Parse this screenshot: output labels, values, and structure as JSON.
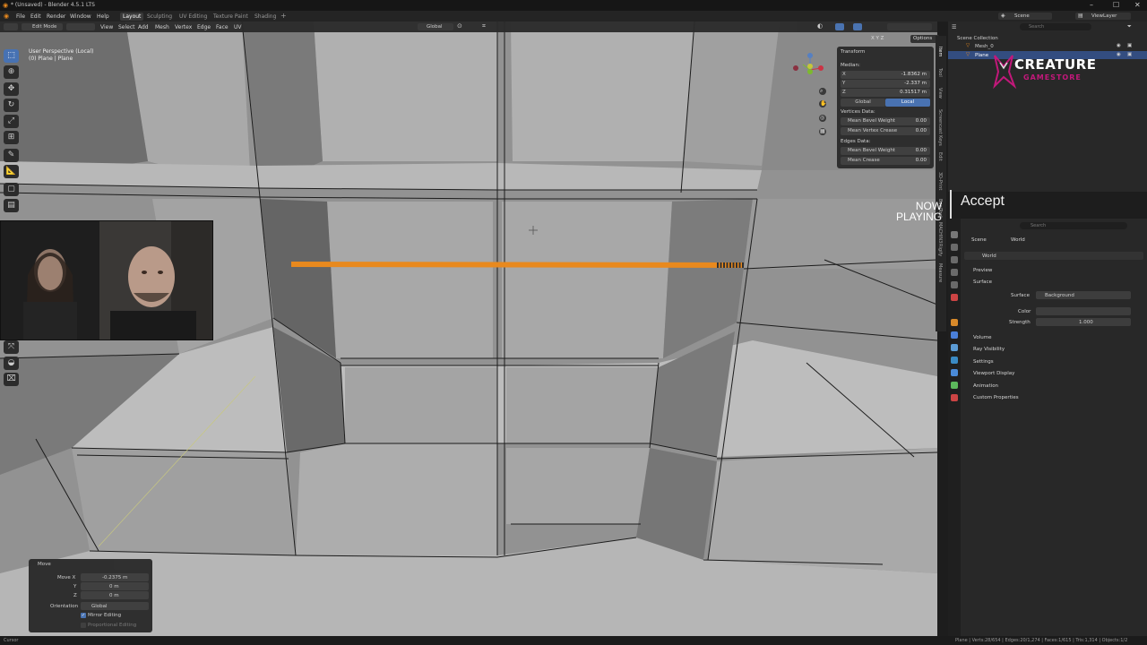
{
  "window": {
    "title": "* (Unsaved) - Blender 4.5.1 LTS"
  },
  "menus": [
    "File",
    "Edit",
    "Render",
    "Window",
    "Help"
  ],
  "workspaces": [
    "Layout",
    "Sculpting",
    "UV Editing",
    "Texture Paint",
    "Shading"
  ],
  "scene": {
    "scene_label": "Scene",
    "view_layer_label": "ViewLayer"
  },
  "viewport": {
    "mode": "Edit Mode",
    "menu": [
      "View",
      "Select",
      "Add",
      "Mesh",
      "Vertex",
      "Edge",
      "Face",
      "UV"
    ],
    "transform_orientation": "Global",
    "options_label": "Options",
    "axes_label": "X Y Z",
    "info_line1": "User Perspective (Local)",
    "info_line2": "(0) Plane | Plane"
  },
  "npanel": {
    "title": "Transform",
    "median": "Median:",
    "x_label": "X",
    "x_value": "-1.8362 m",
    "y_label": "Y",
    "y_value": "-2.337 m",
    "z_label": "Z",
    "z_value": "0.31517 m",
    "global_label": "Global",
    "local_label": "Local",
    "vertices_data": "Vertices Data:",
    "mean_bevel_weight": "Mean Bevel Weight",
    "mean_bevel_weight_value": "0.00",
    "mean_vertex_crease": "Mean Vertex Crease",
    "mean_vertex_crease_value": "0.00",
    "edges_data": "Edges Data:",
    "edge_bevel_weight": "Mean Bevel Weight",
    "edge_bevel_weight_value": "0.00",
    "mean_crease": "Mean Crease",
    "mean_crease_value": "0.00"
  },
  "sidebar_tabs": [
    "Item",
    "Tool",
    "View",
    "Screencast Keys",
    "Edit",
    "3D-Print",
    "BoolTool",
    "MACHIN3",
    "Rigify",
    "Measure"
  ],
  "outliner": {
    "root": "Scene Collection",
    "items": [
      {
        "label": "Mesh_0"
      },
      {
        "label": "Plane"
      }
    ],
    "search_placeholder": "Search"
  },
  "logo": {
    "line1": "CREATURE",
    "line2": "GAMESTORE"
  },
  "overlay": {
    "now_playing_1": "NOW",
    "now_playing_2": "PLAYING",
    "accept": "Accept"
  },
  "properties": {
    "search_placeholder": "Search",
    "breadcrumb_scene": "Scene",
    "breadcrumb_world": "World",
    "world_name": "World",
    "panels": {
      "preview": "Preview",
      "surface": "Surface",
      "surface_label": "Surface",
      "surface_value": "Background",
      "color_label": "Color",
      "strength_label": "Strength",
      "strength_value": "1.000",
      "volume": "Volume",
      "ray_visibility": "Ray Visibility",
      "settings": "Settings",
      "viewport_display": "Viewport Display",
      "animation": "Animation",
      "custom_properties": "Custom Properties"
    }
  },
  "move_panel": {
    "title": "Move",
    "move_x_label": "Move X",
    "move_x_value": "-0.2375 m",
    "y_label": "Y",
    "y_value": "0 m",
    "z_label": "Z",
    "z_value": "0 m",
    "orientation_label": "Orientation",
    "orientation_value": "Global",
    "mirror_editing": "Mirror Editing",
    "proportional_editing": "Proportional Editing"
  },
  "statusbar": {
    "left": "Cursor",
    "right": "Plane | Verts:28/654 | Edges:20/1,274 | Faces:1/615 | Tris:1,314 | Objects:1/2"
  },
  "colors": {
    "selection": "#e8891e",
    "active_blue": "#4772b3",
    "logo_magenta": "#c2187a"
  }
}
